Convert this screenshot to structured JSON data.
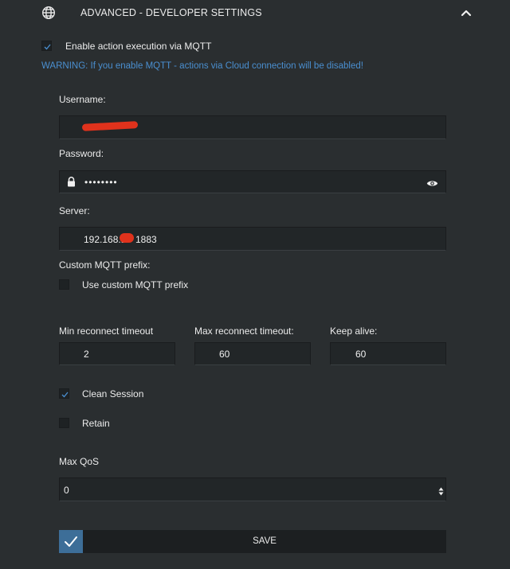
{
  "header": {
    "title": "ADVANCED - DEVELOPER SETTINGS",
    "icon": "globe-icon",
    "toggle_icon": "chevron-up-icon"
  },
  "mqtt": {
    "enable_label": "Enable action execution via MQTT",
    "enable_checked": true,
    "warning": "WARNING: If you enable MQTT - actions via Cloud connection will be disabled!"
  },
  "username": {
    "label": "Username:",
    "value": ""
  },
  "password": {
    "label": "Password:",
    "value": "••••••••",
    "lock_icon": "lock-icon",
    "eye_icon": "eye-icon"
  },
  "server": {
    "label": "Server:",
    "value_prefix": "192.168.1",
    "value_suffix": "1883"
  },
  "prefix": {
    "label": "Custom MQTT prefix:",
    "checkbox_label": "Use custom MQTT prefix",
    "checked": false
  },
  "timeouts": {
    "min_label": "Min reconnect timeout",
    "min_value": "2",
    "max_label": "Max reconnect timeout:",
    "max_value": "60",
    "keepalive_label": "Keep alive:",
    "keepalive_value": "60"
  },
  "clean_session": {
    "label": "Clean Session",
    "checked": true
  },
  "retain": {
    "label": "Retain",
    "checked": false
  },
  "qos": {
    "label": "Max QoS",
    "value": "0"
  },
  "save": {
    "label": "SAVE"
  },
  "colors": {
    "accent": "#3d6e98",
    "warning": "#4a8fd0",
    "background": "#2a2e30"
  }
}
